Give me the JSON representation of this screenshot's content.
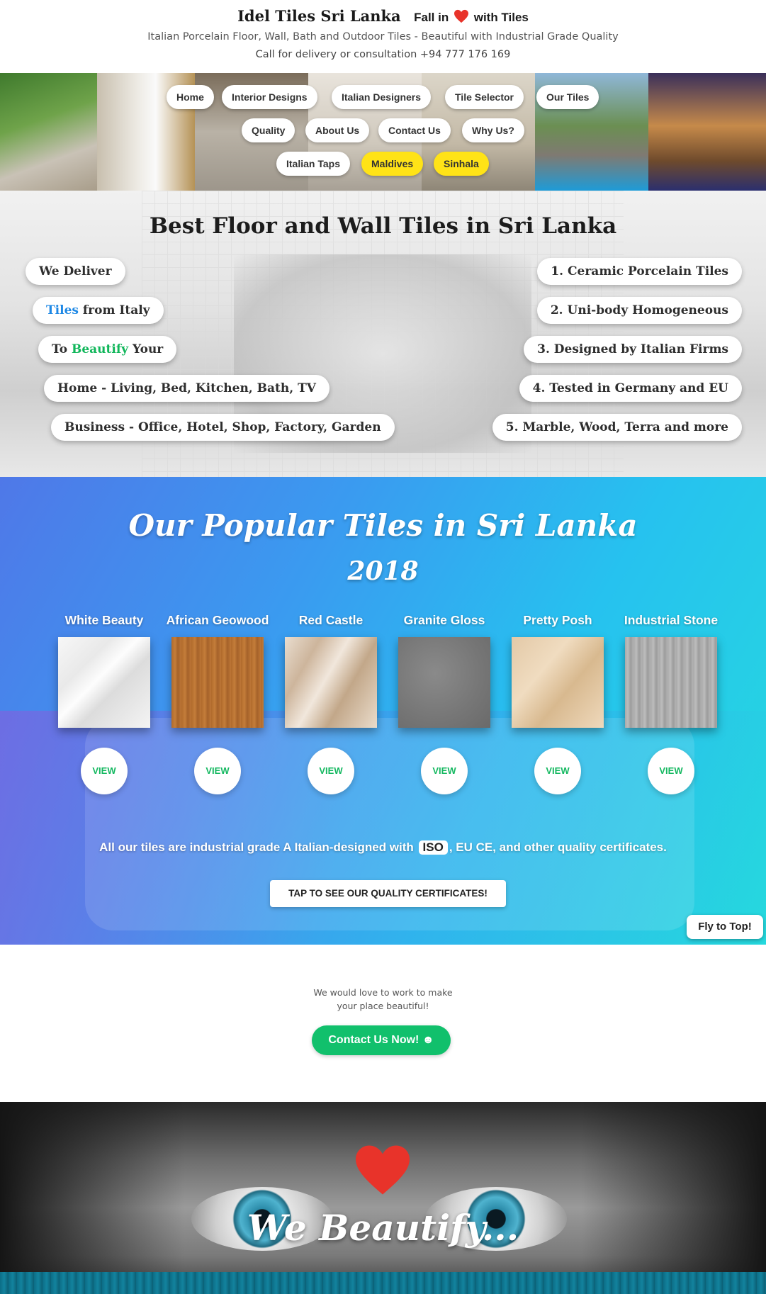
{
  "header": {
    "brand": "Idel Tiles Sri Lanka",
    "tagline_pre": "Fall in",
    "tagline_post": "with Tiles",
    "subtitle": "Italian Porcelain Floor, Wall, Bath and Outdoor Tiles - Beautiful with Industrial Grade Quality",
    "call": "Call for delivery or consultation +94 777 176 169",
    "heart_color": "#e8332a"
  },
  "nav": {
    "home": "Home",
    "interior": "Interior Designs",
    "italian_designers": "Italian Designers",
    "tile_selector": "Tile Selector",
    "our_tiles": "Our Tiles",
    "quality": "Quality",
    "about": "About Us",
    "contact": "Contact Us",
    "why": "Why Us?",
    "taps": "Italian Taps",
    "maldives": "Maldives",
    "sinhala": "Sinhala",
    "highlight_color": "#ffe317"
  },
  "best": {
    "title": "Best Floor and Wall Tiles in Sri Lanka",
    "left": {
      "deliver": "We Deliver",
      "tiles_word": "Tiles",
      "from_italy": " from Italy",
      "to_word": "To ",
      "beautify_word": "Beautify",
      "your_word": " Your",
      "home": "Home - Living, Bed, Kitchen, Bath, TV",
      "business": "Business - Office, Hotel, Shop, Factory, Garden"
    },
    "right": {
      "item1": "1. Ceramic Porcelain Tiles",
      "item2": "2. Uni-body Homogeneous",
      "item3": "3. Designed by Italian Firms",
      "item4": "4. Tested in Germany and EU",
      "item5": "5. Marble, Wood, Terra and more"
    },
    "accent_blue": "#1e88e5",
    "accent_green": "#10b65a"
  },
  "popular": {
    "title": "Our Popular Tiles in Sri Lanka",
    "year": "2018",
    "tiles": [
      {
        "name": "White Beauty",
        "view": "VIEW",
        "swatch": "marble-white"
      },
      {
        "name": "African Geowood",
        "view": "VIEW",
        "swatch": "wood-brown"
      },
      {
        "name": "Red Castle",
        "view": "VIEW",
        "swatch": "marble-beige"
      },
      {
        "name": "Granite Gloss",
        "view": "VIEW",
        "swatch": "granite-grey"
      },
      {
        "name": "Pretty Posh",
        "view": "VIEW",
        "swatch": "marble-cream"
      },
      {
        "name": "Industrial Stone",
        "view": "VIEW",
        "swatch": "stone-grey"
      }
    ],
    "cert_pre": "All our tiles are industrial grade A Italian-designed with",
    "cert_iso": "ISO",
    "cert_post": ", EU CE, and other quality certificates.",
    "cert_button": "TAP TO SEE OUR QUALITY CERTIFICATES!",
    "view_color": "#14b860"
  },
  "fly_top": "Fly to Top!",
  "contact": {
    "line1": "We would love to work to make",
    "line2": "your place beautiful!",
    "button": "Contact Us Now! ☻",
    "button_color": "#11c06c"
  },
  "beautify": {
    "text": "We Beautify...",
    "heart_color": "#e8332a"
  }
}
